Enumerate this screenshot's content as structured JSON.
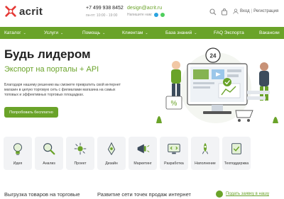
{
  "header": {
    "logo_text": "acrit",
    "phone": "+7 499 938 8452",
    "hours": "пн-пт: 10:00 - 19:00",
    "email": "design@acrit.ru",
    "contact_note": "Напишите нам:",
    "login_label": "Вход",
    "register_label": "Регистрация"
  },
  "nav": {
    "items": [
      {
        "label": "Каталог",
        "has_chevron": true
      },
      {
        "label": "Услуги",
        "has_chevron": true
      },
      {
        "label": "Помощь",
        "has_chevron": true
      },
      {
        "label": "Клиентам",
        "has_chevron": true
      },
      {
        "label": "База знаний",
        "has_chevron": true
      },
      {
        "label": "FAQ Экспорта",
        "has_chevron": false
      },
      {
        "label": "Вакансии",
        "has_chevron": false
      }
    ]
  },
  "hero": {
    "title": "Будь лидером",
    "subtitle": "Экспорт на порталы + API",
    "description": "Благодаря нашему решению вы сможете превратить свой интернет магазин в целую торговую сеть с филиалами магазина на самых топовых и эффективных торговых площадках.",
    "cta_label": "Попробовать бесплатно",
    "badge_text": "24"
  },
  "services": [
    {
      "label": "Идея",
      "icon": "idea-icon"
    },
    {
      "label": "Анализ",
      "icon": "analysis-icon"
    },
    {
      "label": "Проект",
      "icon": "project-icon"
    },
    {
      "label": "Дизайн",
      "icon": "design-icon"
    },
    {
      "label": "Маркетинг",
      "icon": "marketing-icon"
    },
    {
      "label": "Разработка",
      "icon": "development-icon"
    },
    {
      "label": "Наполнение",
      "icon": "content-icon"
    },
    {
      "label": "Техподдержка",
      "icon": "support-icon"
    }
  ],
  "bottom": {
    "col1": "Выгрузка товаров на торговые",
    "col2": "Развитие сети точек продаж интернет",
    "col3_link": "Подать заявку в нашу"
  },
  "colors": {
    "accent": "#6aa329",
    "tile_bg": "#f2f3f5"
  }
}
